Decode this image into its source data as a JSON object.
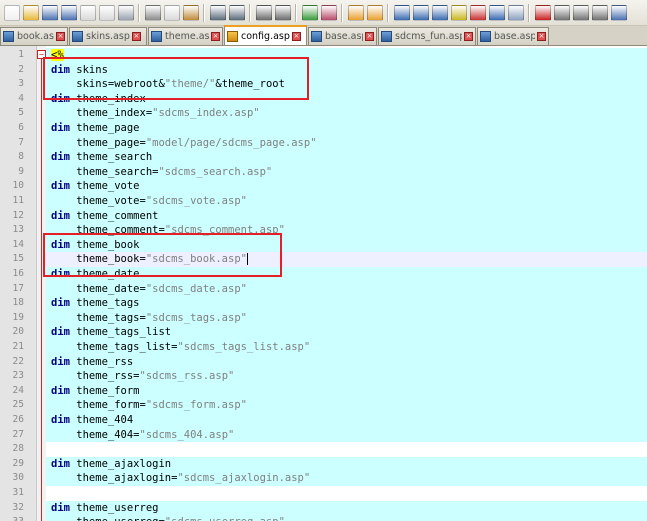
{
  "toolbar": {
    "buttons": [
      {
        "icon": "new-file-icon",
        "color": "#f1f1f1"
      },
      {
        "icon": "open-file-icon",
        "color": "#e8b838"
      },
      {
        "icon": "save-icon",
        "color": "#4a6fb0"
      },
      {
        "icon": "save-all-icon",
        "color": "#4a6fb0"
      },
      {
        "icon": "close-file-icon",
        "color": "#d9d9d9"
      },
      {
        "icon": "close-all-icon",
        "color": "#d9d9d9"
      },
      {
        "icon": "print-icon",
        "color": "#9aa2ae"
      },
      {
        "sep": true
      },
      {
        "icon": "cut-icon",
        "color": "#8c8c8c"
      },
      {
        "icon": "copy-icon",
        "color": "#d9d9d9"
      },
      {
        "icon": "paste-icon",
        "color": "#c08a3a"
      },
      {
        "sep": true
      },
      {
        "icon": "undo-icon",
        "color": "#5a6a7a"
      },
      {
        "icon": "redo-icon",
        "color": "#5a6a7a"
      },
      {
        "sep": true
      },
      {
        "icon": "find-icon",
        "color": "#6a6a6a"
      },
      {
        "icon": "replace-icon",
        "color": "#6a6a6a"
      },
      {
        "sep": true
      },
      {
        "icon": "zoom-in-icon",
        "color": "#3a9a3a"
      },
      {
        "icon": "zoom-out-icon",
        "color": "#b84a6a"
      },
      {
        "sep": true
      },
      {
        "icon": "sync-vertical-icon",
        "color": "#e8a030"
      },
      {
        "icon": "sync-horizontal-icon",
        "color": "#e8a030"
      },
      {
        "sep": true
      },
      {
        "icon": "word-wrap-icon",
        "color": "#3a6ab0"
      },
      {
        "icon": "show-all-chars-icon",
        "color": "#3a6ab0"
      },
      {
        "icon": "indent-guide-icon",
        "color": "#3a6ab0"
      },
      {
        "icon": "user-lang-icon",
        "color": "#c8b820"
      },
      {
        "icon": "doc-map-icon",
        "color": "#c83030"
      },
      {
        "icon": "function-list-icon",
        "color": "#3a6ab0"
      },
      {
        "icon": "monitor-icon",
        "color": "#8aa0c0"
      },
      {
        "sep": true
      },
      {
        "icon": "record-macro-icon",
        "color": "#c82020"
      },
      {
        "icon": "stop-macro-icon",
        "color": "#707070"
      },
      {
        "icon": "play-macro-icon",
        "color": "#707070"
      },
      {
        "icon": "run-macro-multiple-icon",
        "color": "#707070"
      },
      {
        "icon": "save-macro-icon",
        "color": "#4a6fb0"
      }
    ]
  },
  "tabs": [
    {
      "label": "book.asp",
      "active": false,
      "width": 68
    },
    {
      "label": "skins.asp",
      "active": false,
      "width": 78
    },
    {
      "label": "theme.asp",
      "active": false,
      "width": 75
    },
    {
      "label": "config.asp",
      "active": true,
      "width": 83
    },
    {
      "label": "base.asp",
      "active": false,
      "width": 69
    },
    {
      "label": "sdcms_fun.asp",
      "active": false,
      "width": 98
    },
    {
      "label": "base.asp",
      "active": false,
      "width": 72
    }
  ],
  "lines": [
    {
      "n": "1",
      "segments": [
        {
          "t": "<%",
          "c": "asp-open"
        }
      ]
    },
    {
      "n": "2",
      "segments": [
        {
          "t": "dim",
          "c": "kw"
        },
        {
          "t": " skins",
          "c": ""
        }
      ]
    },
    {
      "n": "3",
      "segments": [
        {
          "t": "    skins=webroot&",
          "c": ""
        },
        {
          "t": "\"theme/\"",
          "c": "str"
        },
        {
          "t": "&theme_root",
          "c": ""
        }
      ]
    },
    {
      "n": "4",
      "segments": [
        {
          "t": "dim",
          "c": "kw"
        },
        {
          "t": " theme_index",
          "c": ""
        }
      ]
    },
    {
      "n": "5",
      "segments": [
        {
          "t": "    theme_index=",
          "c": ""
        },
        {
          "t": "\"sdcms_index.asp\"",
          "c": "str"
        }
      ]
    },
    {
      "n": "6",
      "segments": [
        {
          "t": "dim",
          "c": "kw"
        },
        {
          "t": " theme_page",
          "c": ""
        }
      ]
    },
    {
      "n": "7",
      "segments": [
        {
          "t": "    theme_page=",
          "c": ""
        },
        {
          "t": "\"model/page/sdcms_page.asp\"",
          "c": "str"
        }
      ]
    },
    {
      "n": "8",
      "segments": [
        {
          "t": "dim",
          "c": "kw"
        },
        {
          "t": " theme_search",
          "c": ""
        }
      ]
    },
    {
      "n": "9",
      "segments": [
        {
          "t": "    theme_search=",
          "c": ""
        },
        {
          "t": "\"sdcms_search.asp\"",
          "c": "str"
        }
      ]
    },
    {
      "n": "10",
      "segments": [
        {
          "t": "dim",
          "c": "kw"
        },
        {
          "t": " theme_vote",
          "c": ""
        }
      ]
    },
    {
      "n": "11",
      "segments": [
        {
          "t": "    theme_vote=",
          "c": ""
        },
        {
          "t": "\"sdcms_vote.asp\"",
          "c": "str"
        }
      ]
    },
    {
      "n": "12",
      "segments": [
        {
          "t": "dim",
          "c": "kw"
        },
        {
          "t": " theme_comment",
          "c": ""
        }
      ]
    },
    {
      "n": "13",
      "segments": [
        {
          "t": "    theme_comment=",
          "c": ""
        },
        {
          "t": "\"sdcms_comment.asp\"",
          "c": "str"
        }
      ]
    },
    {
      "n": "14",
      "segments": [
        {
          "t": "dim",
          "c": "kw"
        },
        {
          "t": " theme_book",
          "c": ""
        }
      ]
    },
    {
      "n": "15",
      "segments": [
        {
          "t": "    theme_book=",
          "c": ""
        },
        {
          "t": "\"sdcms_book.asp\"",
          "c": "str"
        }
      ],
      "current": true
    },
    {
      "n": "16",
      "segments": [
        {
          "t": "dim",
          "c": "kw"
        },
        {
          "t": " theme_date",
          "c": ""
        }
      ]
    },
    {
      "n": "17",
      "segments": [
        {
          "t": "    theme_date=",
          "c": ""
        },
        {
          "t": "\"sdcms_date.asp\"",
          "c": "str"
        }
      ]
    },
    {
      "n": "18",
      "segments": [
        {
          "t": "dim",
          "c": "kw"
        },
        {
          "t": " theme_tags",
          "c": ""
        }
      ]
    },
    {
      "n": "19",
      "segments": [
        {
          "t": "    theme_tags=",
          "c": ""
        },
        {
          "t": "\"sdcms_tags.asp\"",
          "c": "str"
        }
      ]
    },
    {
      "n": "20",
      "segments": [
        {
          "t": "dim",
          "c": "kw"
        },
        {
          "t": " theme_tags_list",
          "c": ""
        }
      ]
    },
    {
      "n": "21",
      "segments": [
        {
          "t": "    theme_tags_list=",
          "c": ""
        },
        {
          "t": "\"sdcms_tags_list.asp\"",
          "c": "str"
        }
      ]
    },
    {
      "n": "22",
      "segments": [
        {
          "t": "dim",
          "c": "kw"
        },
        {
          "t": " theme_rss",
          "c": ""
        }
      ]
    },
    {
      "n": "23",
      "segments": [
        {
          "t": "    theme_rss=",
          "c": ""
        },
        {
          "t": "\"sdcms_rss.asp\"",
          "c": "str"
        }
      ]
    },
    {
      "n": "24",
      "segments": [
        {
          "t": "dim",
          "c": "kw"
        },
        {
          "t": " theme_form",
          "c": ""
        }
      ]
    },
    {
      "n": "25",
      "segments": [
        {
          "t": "    theme_form=",
          "c": ""
        },
        {
          "t": "\"sdcms_form.asp\"",
          "c": "str"
        }
      ]
    },
    {
      "n": "26",
      "segments": [
        {
          "t": "dim",
          "c": "kw"
        },
        {
          "t": " theme_404",
          "c": ""
        }
      ]
    },
    {
      "n": "27",
      "segments": [
        {
          "t": "    theme_404=",
          "c": ""
        },
        {
          "t": "\"sdcms_404.asp\"",
          "c": "str"
        }
      ]
    },
    {
      "n": "28",
      "segments": [],
      "blank": true
    },
    {
      "n": "29",
      "segments": [
        {
          "t": "dim",
          "c": "kw"
        },
        {
          "t": " theme_ajaxlogin",
          "c": ""
        }
      ]
    },
    {
      "n": "30",
      "segments": [
        {
          "t": "    theme_ajaxlogin=",
          "c": ""
        },
        {
          "t": "\"sdcms_ajaxlogin.asp\"",
          "c": "str"
        }
      ]
    },
    {
      "n": "31",
      "segments": [],
      "blank": true
    },
    {
      "n": "32",
      "segments": [
        {
          "t": "dim",
          "c": "kw"
        },
        {
          "t": " theme_userreg",
          "c": ""
        }
      ]
    },
    {
      "n": "33",
      "segments": [
        {
          "t": "    theme_userreg=",
          "c": ""
        },
        {
          "t": "\"sdcms_userreg.asp\"",
          "c": "str"
        }
      ]
    }
  ],
  "colors": {
    "annotation_box": "#e41f27",
    "code_bg": "#ccffff",
    "keyword": "#000080",
    "string": "#808080"
  }
}
